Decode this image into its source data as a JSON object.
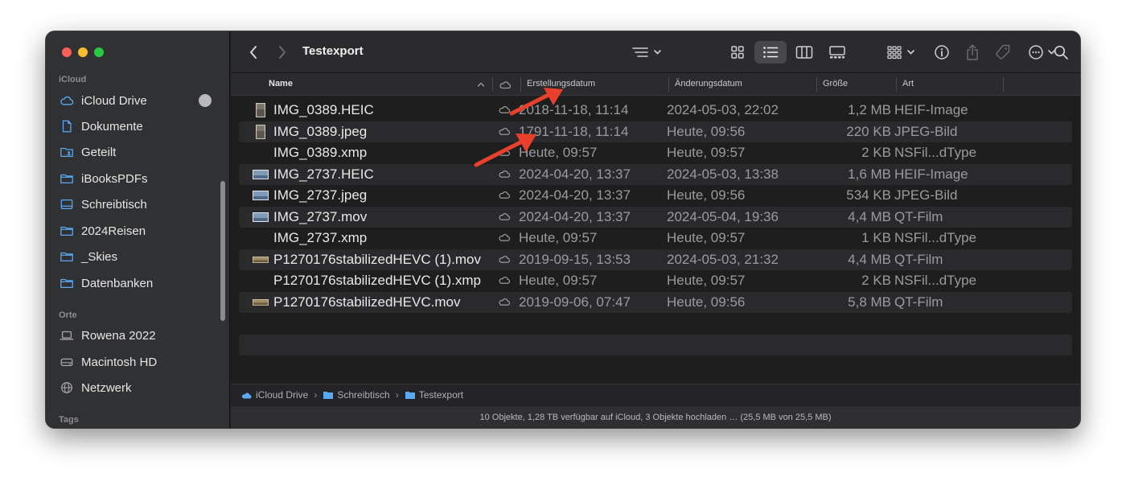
{
  "window": {
    "title": "Testexport"
  },
  "colors": {
    "close": "#ff5f57",
    "minimize": "#febc2e",
    "zoom": "#28c840",
    "accent": "#5aa9f5",
    "arrow": "#e8402a"
  },
  "sidebar": {
    "icloud_heading": "iCloud",
    "icloud_items": [
      {
        "label": "iCloud Drive",
        "icon": "cloud-icon"
      },
      {
        "label": "Dokumente",
        "icon": "document-icon"
      },
      {
        "label": "Geteilt",
        "icon": "shared-folder-icon"
      },
      {
        "label": "iBooksPDFs",
        "icon": "folder-icon"
      },
      {
        "label": "Schreibtisch",
        "icon": "desktop-icon"
      },
      {
        "label": "2024Reisen",
        "icon": "folder-icon"
      },
      {
        "label": "_Skies",
        "icon": "folder-icon"
      },
      {
        "label": "Datenbanken",
        "icon": "folder-icon"
      }
    ],
    "orte_heading": "Orte",
    "orte_items": [
      {
        "label": "Rowena 2022",
        "icon": "laptop-icon"
      },
      {
        "label": "Macintosh HD",
        "icon": "disk-icon"
      },
      {
        "label": "Netzwerk",
        "icon": "globe-icon"
      }
    ],
    "tags_heading": "Tags"
  },
  "columns": {
    "name": "Name",
    "created": "Erstellungsdatum",
    "modified": "Änderungsdatum",
    "size": "Größe",
    "kind": "Art"
  },
  "files": [
    {
      "name": "IMG_0389.HEIC",
      "created": "2018-11-18, 11:14",
      "modified": "2024-05-03, 22:02",
      "size": "1,2 MB",
      "kind": "HEIF-Image",
      "thumb": "portrait"
    },
    {
      "name": "IMG_0389.jpeg",
      "created": "1791-11-18, 11:14",
      "modified": "Heute, 09:56",
      "size": "220 KB",
      "kind": "JPEG-Bild",
      "thumb": "portrait"
    },
    {
      "name": "IMG_0389.xmp",
      "created": "Heute, 09:57",
      "modified": "Heute, 09:57",
      "size": "2 KB",
      "kind": "NSFil...dType",
      "thumb": "none"
    },
    {
      "name": "IMG_2737.HEIC",
      "created": "2024-04-20, 13:37",
      "modified": "2024-05-03, 13:38",
      "size": "1,6 MB",
      "kind": "HEIF-Image",
      "thumb": "landscape"
    },
    {
      "name": "IMG_2737.jpeg",
      "created": "2024-04-20, 13:37",
      "modified": "Heute, 09:56",
      "size": "534 KB",
      "kind": "JPEG-Bild",
      "thumb": "landscape"
    },
    {
      "name": "IMG_2737.mov",
      "created": "2024-04-20, 13:37",
      "modified": "2024-05-04, 19:36",
      "size": "4,4 MB",
      "kind": "QT-Film",
      "thumb": "landscape"
    },
    {
      "name": "IMG_2737.xmp",
      "created": "Heute, 09:57",
      "modified": "Heute, 09:57",
      "size": "1 KB",
      "kind": "NSFil...dType",
      "thumb": "none"
    },
    {
      "name": "P1270176stabilizedHEVC (1).mov",
      "created": "2019-09-15, 13:53",
      "modified": "2024-05-03, 21:32",
      "size": "4,4 MB",
      "kind": "QT-Film",
      "thumb": "wide"
    },
    {
      "name": "P1270176stabilizedHEVC (1).xmp",
      "created": "Heute, 09:57",
      "modified": "Heute, 09:57",
      "size": "2 KB",
      "kind": "NSFil...dType",
      "thumb": "none"
    },
    {
      "name": "P1270176stabilizedHEVC.mov",
      "created": "2019-09-06, 07:47",
      "modified": "Heute, 09:56",
      "size": "5,8 MB",
      "kind": "QT-Film",
      "thumb": "wide"
    }
  ],
  "pathbar": [
    "iCloud Drive",
    "Schreibtisch",
    "Testexport"
  ],
  "status": "10 Objekte, 1,28 TB verfügbar auf iCloud, 3 Objekte hochladen … (25,5 MB von 25,5 MB)"
}
